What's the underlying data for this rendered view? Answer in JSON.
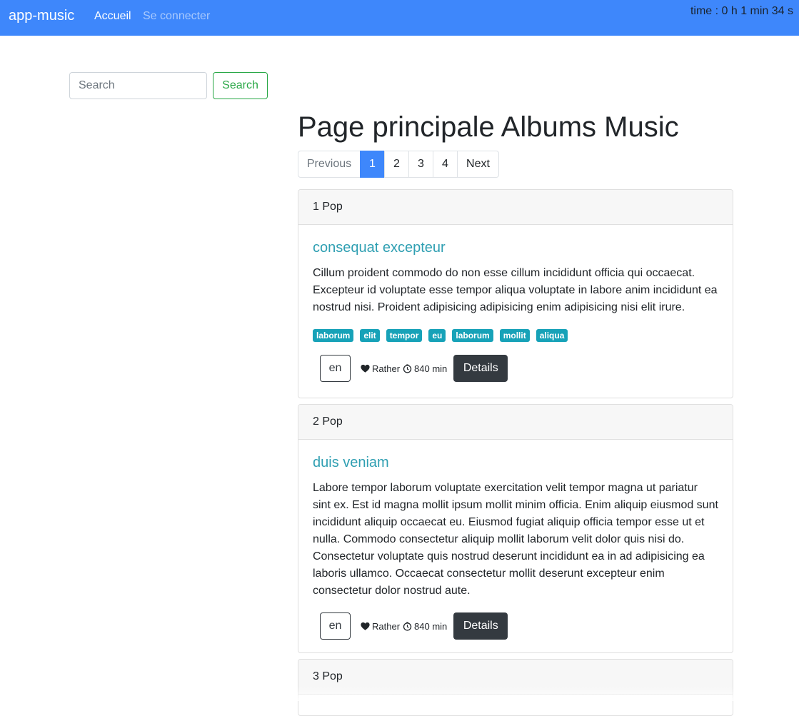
{
  "navbar": {
    "brand": "app-music",
    "links": [
      "Accueil",
      "Se connecter"
    ],
    "timer": "time : 0 h 1 min 34 s",
    "color": "#3e87fb"
  },
  "search": {
    "placeholder": "Search",
    "button_label": "Search"
  },
  "page_title": "Page principale Albums Music",
  "pagination": {
    "previous": "Previous",
    "pages": [
      "1",
      "2",
      "3",
      "4"
    ],
    "next": "Next",
    "active": "1"
  },
  "albums": [
    {
      "header": "1 Pop",
      "title": "consequat excepteur",
      "description": "Cillum proident commodo do non esse cillum incididunt officia qui occaecat. Excepteur id voluptate esse tempor aliqua voluptate in labore anim incididunt ea nostrud nisi. Proident adipisicing adipisicing enim adipisicing nisi elit irure.",
      "tags": [
        "laborum",
        "elit",
        "tempor",
        "eu",
        "laborum",
        "mollit",
        "aliqua"
      ],
      "lang": "en",
      "like_label": "Rather",
      "duration": "840 min",
      "details_label": "Details"
    },
    {
      "header": "2 Pop",
      "title": "duis veniam",
      "description": "Labore tempor laborum voluptate exercitation velit tempor magna ut pariatur sint ex. Est id magna mollit ipsum mollit minim officia. Enim aliquip eiusmod sunt incididunt aliquip occaecat eu. Eiusmod fugiat aliquip officia tempor esse ut et nulla. Commodo consectetur aliquip mollit laborum velit dolor quis nisi do. Consectetur voluptate quis nostrud deserunt incididunt ea in ad adipisicing ea laboris ullamco. Occaecat consectetur mollit deserunt excepteur enim consectetur dolor nostrud aute.",
      "tags": [],
      "lang": "en",
      "like_label": "Rather",
      "duration": "840 min",
      "details_label": "Details"
    },
    {
      "header": "3 Pop"
    }
  ],
  "colors": {
    "title": "#2f9fb2",
    "tag": "#17a2b8",
    "dark_button": "#343a40",
    "search_accent": "#28a745"
  }
}
